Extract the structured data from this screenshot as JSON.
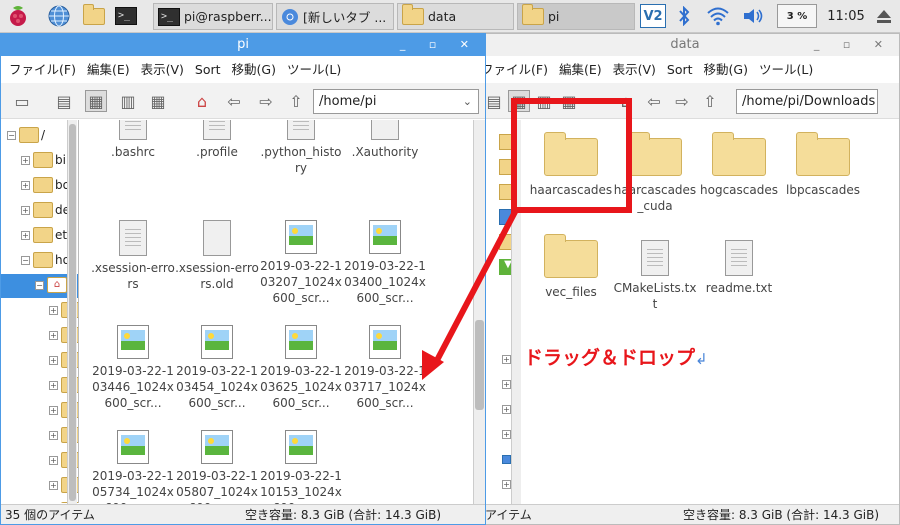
{
  "taskbar": {
    "tasks": [
      {
        "label": "pi@raspberr..."
      },
      {
        "label": "[新しいタブ ..."
      },
      {
        "label": "data"
      },
      {
        "label": "pi"
      }
    ],
    "cpu": "3 %",
    "time": "11:05",
    "vnc": "V2"
  },
  "left_window": {
    "title": "pi",
    "menu": [
      "ファイル(F)",
      "編集(E)",
      "表示(V)",
      "Sort",
      "移動(G)",
      "ツール(L)"
    ],
    "path": "/home/pi",
    "tree": [
      {
        "label": "/",
        "expander": "−"
      },
      {
        "label": "bi",
        "expander": "+"
      },
      {
        "label": "bo",
        "expander": "+"
      },
      {
        "label": "de",
        "expander": "+"
      },
      {
        "label": "et",
        "expander": "+"
      },
      {
        "label": "ho",
        "expander": "−"
      },
      {
        "label": "",
        "expander": "−"
      },
      {
        "label": "",
        "expander": "+"
      },
      {
        "label": "",
        "expander": "+"
      },
      {
        "label": "",
        "expander": "+"
      },
      {
        "label": "",
        "expander": "+"
      },
      {
        "label": "",
        "expander": "+"
      },
      {
        "label": "",
        "expander": "+"
      },
      {
        "label": "",
        "expander": "+"
      },
      {
        "label": "",
        "expander": "+"
      },
      {
        "label": "",
        "expander": "+"
      }
    ],
    "files": [
      {
        "name": ".bashrc",
        "kind": "doc"
      },
      {
        "name": ".profile",
        "kind": "doc"
      },
      {
        "name": ".python_history",
        "kind": "doc"
      },
      {
        "name": ".Xauthority",
        "kind": "blank"
      },
      {
        "name": ".xsession-errors",
        "kind": "doc"
      },
      {
        "name": ".xsession-errors.old",
        "kind": "blank"
      },
      {
        "name": "2019-03-22-103207_1024x600_scr...",
        "kind": "img"
      },
      {
        "name": "2019-03-22-103400_1024x600_scr...",
        "kind": "img"
      },
      {
        "name": "2019-03-22-103446_1024x600_scr...",
        "kind": "img"
      },
      {
        "name": "2019-03-22-103454_1024x600_scr...",
        "kind": "img"
      },
      {
        "name": "2019-03-22-103625_1024x600_scr...",
        "kind": "img"
      },
      {
        "name": "2019-03-22-103717_1024x600_scr...",
        "kind": "img"
      },
      {
        "name": "2019-03-22-105734_1024x600_scr...",
        "kind": "img"
      },
      {
        "name": "2019-03-22-105807_1024x600_scr...",
        "kind": "img"
      },
      {
        "name": "2019-03-22-110153_1024x600_scr...",
        "kind": "img"
      }
    ],
    "status_left": "35 個のアイテム",
    "status_right": "空き容量: 8.3 GiB (合計: 14.3 GiB)"
  },
  "right_window": {
    "title": "data",
    "menu": [
      "ファイル(F)",
      "編集(E)",
      "表示(V)",
      "Sort",
      "移動(G)",
      "ツール(L)"
    ],
    "path": "/home/pi/Downloads",
    "files": [
      {
        "name": "haarcascades",
        "kind": "folder"
      },
      {
        "name": "haarcascades_cuda",
        "kind": "folder"
      },
      {
        "name": "hogcascades",
        "kind": "folder"
      },
      {
        "name": "lbpcascades",
        "kind": "folder"
      },
      {
        "name": "vec_files",
        "kind": "folder"
      },
      {
        "name": "CMakeLists.txt",
        "kind": "doc"
      },
      {
        "name": "readme.txt",
        "kind": "doc"
      }
    ],
    "status_left": "アイテム",
    "status_right": "空き容量: 8.3 GiB (合計: 14.3 GiB)"
  },
  "annotation": {
    "text": "ドラッグ＆ドロップ",
    "mark": "↲",
    "color": "#e8161b"
  },
  "colors": {
    "titlebar_active": "#4d9be6",
    "titlebar_inactive": "#f0f0f0",
    "selection": "#3d8fe0"
  }
}
